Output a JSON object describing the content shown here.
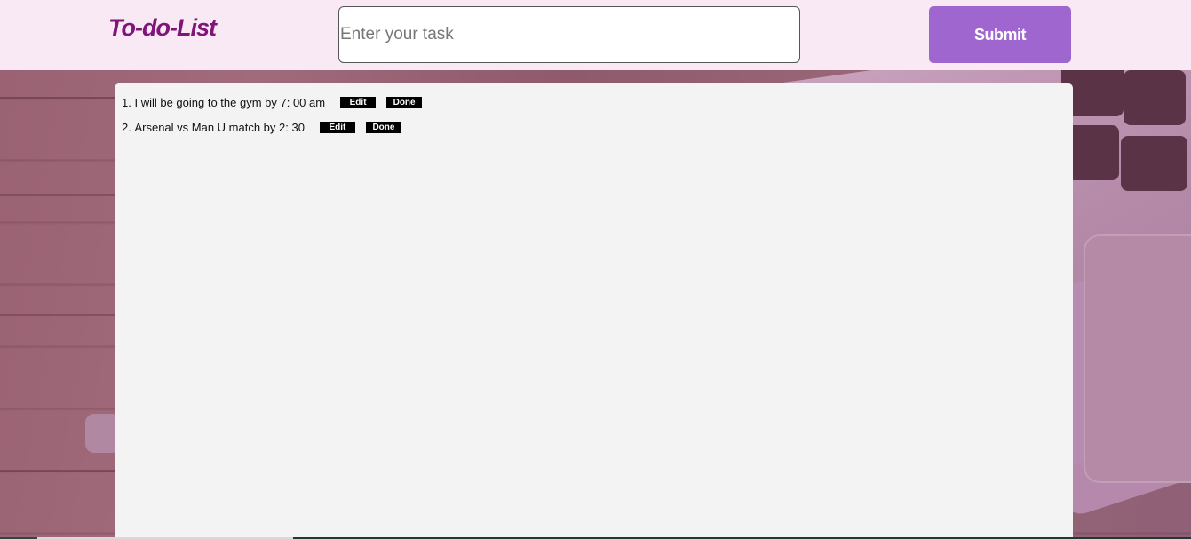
{
  "app": {
    "logo": "To-do-List"
  },
  "form": {
    "input_placeholder": "Enter your task",
    "input_value": "",
    "submit_label": "Submit"
  },
  "tasks": [
    {
      "number": "1.",
      "text": "I will be going to the gym by 7: 00 am",
      "edit_label": "Edit",
      "done_label": "Done"
    },
    {
      "number": "2.",
      "text": "Arsenal vs Man U match by 2: 30",
      "edit_label": "Edit",
      "done_label": "Done"
    }
  ],
  "colors": {
    "header_bg": "#f8e9f4",
    "logo": "#80147a",
    "submit_bg": "#a066cf",
    "panel_bg": "#f3f3f3",
    "task_button_bg": "#000000"
  }
}
